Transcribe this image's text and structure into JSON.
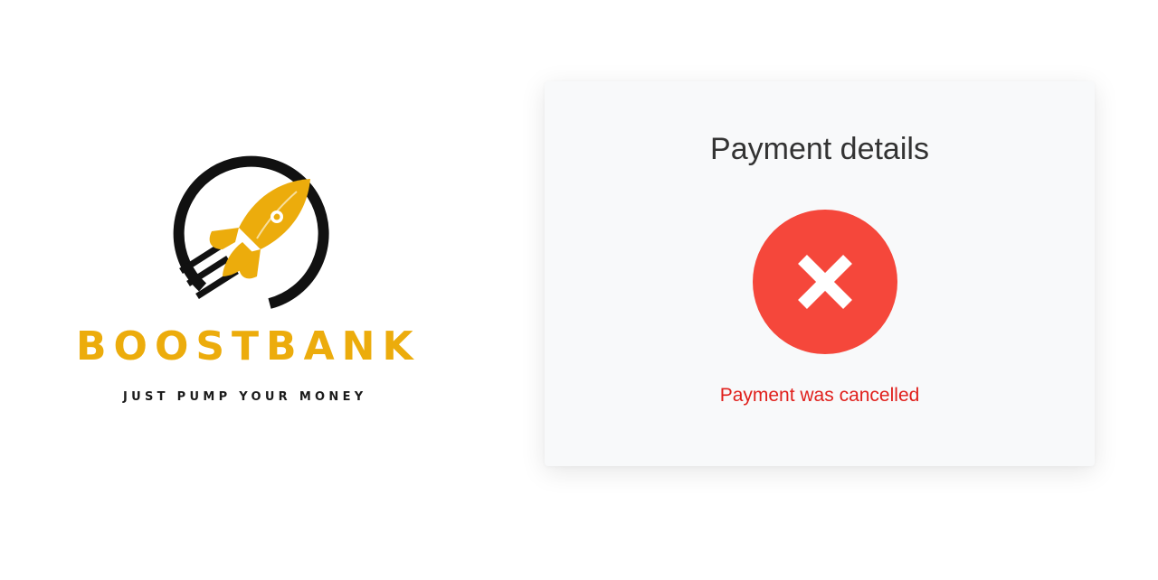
{
  "brand": {
    "name": "BOOSTBANK",
    "tagline": "JUST PUMP YOUR MONEY",
    "logo_icon": "rocket-icon",
    "accent_color": "#ecac0c",
    "dark_color": "#111111"
  },
  "card": {
    "title": "Payment details",
    "status_icon": "close-icon",
    "status_color": "#f5473b",
    "status_message": "Payment was cancelled",
    "status_message_color": "#e0201c"
  }
}
